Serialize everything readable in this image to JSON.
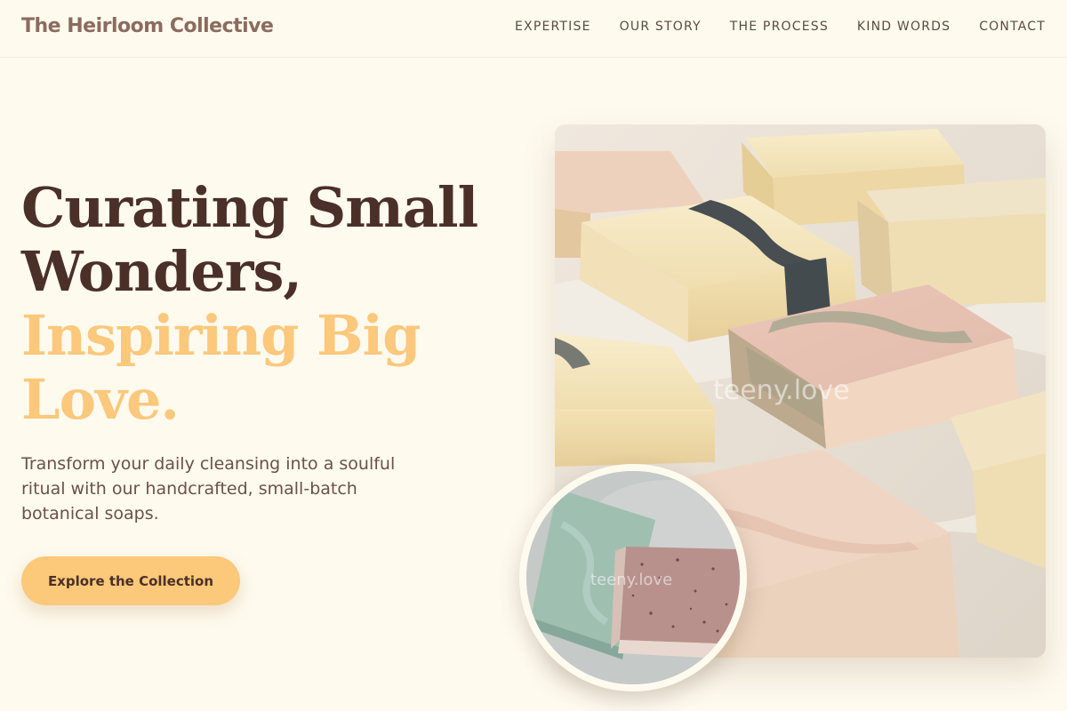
{
  "header": {
    "brand": "The Heirloom Collective",
    "nav": [
      {
        "label": "EXPERTISE"
      },
      {
        "label": "OUR STORY"
      },
      {
        "label": "THE PROCESS"
      },
      {
        "label": "KIND WORDS"
      },
      {
        "label": "CONTACT"
      }
    ]
  },
  "hero": {
    "headline_line1": "Curating Small",
    "headline_line2": "Wonders,",
    "headline_line3": "Inspiring Big",
    "headline_line4": "Love.",
    "subtitle": "Transform your daily cleansing into a soulful ritual with our handcrafted, small-batch botanical soaps.",
    "cta_label": "Explore the Collection"
  },
  "images": {
    "main_watermark": "teeny.love",
    "inset_watermark": "teeny.love"
  },
  "colors": {
    "background": "#fefaee",
    "headline_dark": "#4a3029",
    "headline_accent": "#fbc87c",
    "button": "#fcc879",
    "brand": "#8c6b5f"
  }
}
